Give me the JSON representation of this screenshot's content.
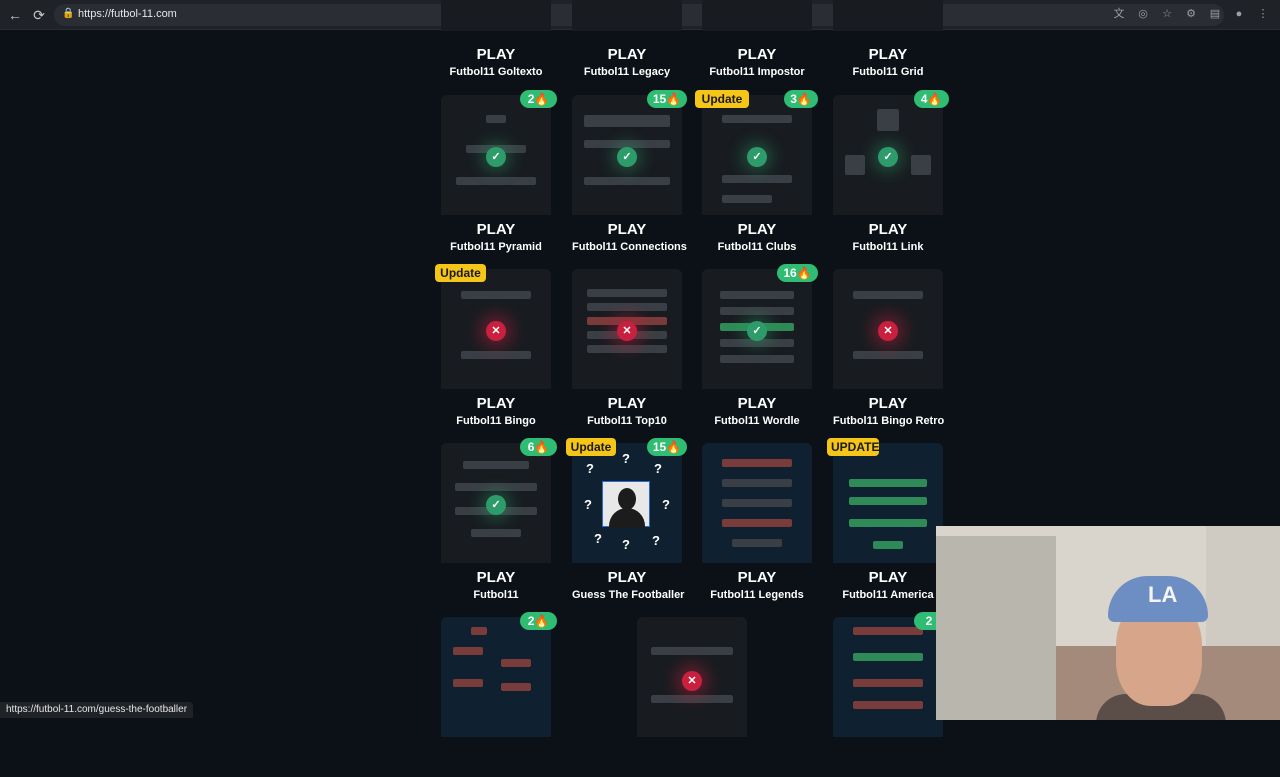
{
  "browser": {
    "url": "https://futbol-11.com",
    "status_url": "https://futbol-11.com/guess-the-footballer"
  },
  "row0": [
    {
      "play": "PLAY",
      "title": "Futbol11 Goltexto"
    },
    {
      "play": "PLAY",
      "title": "Futbol11 Legacy"
    },
    {
      "play": "PLAY",
      "title": "Futbol11 Impostor"
    },
    {
      "play": "PLAY",
      "title": "Futbol11 Grid"
    }
  ],
  "row1": [
    {
      "play": "PLAY",
      "title": "Futbol11 Pyramid",
      "badge": "2🔥"
    },
    {
      "play": "PLAY",
      "title": "Futbol11 Connections",
      "badge": "15🔥"
    },
    {
      "play": "PLAY",
      "title": "Futbol11 Clubs",
      "badge": "3🔥",
      "update": "Update"
    },
    {
      "play": "PLAY",
      "title": "Futbol11 Link",
      "badge": "4🔥"
    }
  ],
  "row2": [
    {
      "play": "PLAY",
      "title": "Futbol11 Bingo",
      "update": "Update"
    },
    {
      "play": "PLAY",
      "title": "Futbol11 Top10"
    },
    {
      "play": "PLAY",
      "title": "Futbol11 Wordle",
      "badge": "16🔥"
    },
    {
      "play": "PLAY",
      "title": "Futbol11 Bingo Retro"
    }
  ],
  "row3": [
    {
      "play": "PLAY",
      "title": "Futbol11",
      "badge": "6🔥"
    },
    {
      "play": "PLAY",
      "title": "Guess The Footballer",
      "badge": "15🔥",
      "update": "Update"
    },
    {
      "play": "PLAY",
      "title": "Futbol11 Legends"
    },
    {
      "play": "PLAY",
      "title": "Futbol11 America",
      "update": "UPDATE"
    }
  ],
  "row4": [
    {
      "badge": "2🔥"
    },
    {},
    {
      "badge": "2"
    }
  ],
  "icons": {
    "back": "←",
    "reload": "⟳",
    "lock": "🔒",
    "check": "✓",
    "cross": "✕",
    "question": "?",
    "translate": "文",
    "globe": "◎",
    "star": "☆",
    "extensions": "⚙",
    "sidebar": "▤",
    "profile": "●",
    "menu": "⋮"
  },
  "webcam": {
    "cap_logo": "LA"
  }
}
